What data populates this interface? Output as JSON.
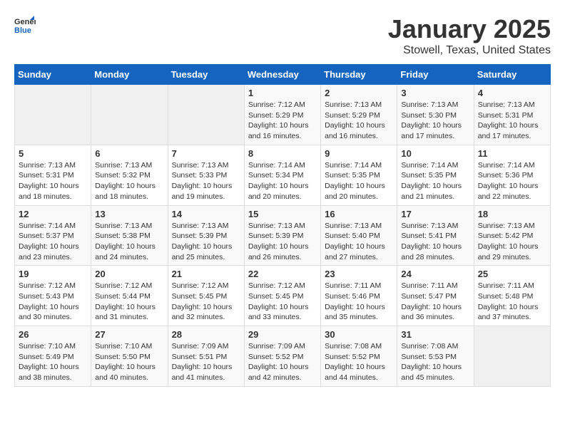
{
  "logo": {
    "general": "General",
    "blue": "Blue"
  },
  "header": {
    "title": "January 2025",
    "subtitle": "Stowell, Texas, United States"
  },
  "days_of_week": [
    "Sunday",
    "Monday",
    "Tuesday",
    "Wednesday",
    "Thursday",
    "Friday",
    "Saturday"
  ],
  "weeks": [
    [
      {
        "day": "",
        "empty": true
      },
      {
        "day": "",
        "empty": true
      },
      {
        "day": "",
        "empty": true
      },
      {
        "day": "1",
        "sunrise": "7:12 AM",
        "sunset": "5:29 PM",
        "daylight": "10 hours and 16 minutes."
      },
      {
        "day": "2",
        "sunrise": "7:13 AM",
        "sunset": "5:29 PM",
        "daylight": "10 hours and 16 minutes."
      },
      {
        "day": "3",
        "sunrise": "7:13 AM",
        "sunset": "5:30 PM",
        "daylight": "10 hours and 17 minutes."
      },
      {
        "day": "4",
        "sunrise": "7:13 AM",
        "sunset": "5:31 PM",
        "daylight": "10 hours and 17 minutes."
      }
    ],
    [
      {
        "day": "5",
        "sunrise": "7:13 AM",
        "sunset": "5:31 PM",
        "daylight": "10 hours and 18 minutes."
      },
      {
        "day": "6",
        "sunrise": "7:13 AM",
        "sunset": "5:32 PM",
        "daylight": "10 hours and 18 minutes."
      },
      {
        "day": "7",
        "sunrise": "7:13 AM",
        "sunset": "5:33 PM",
        "daylight": "10 hours and 19 minutes."
      },
      {
        "day": "8",
        "sunrise": "7:14 AM",
        "sunset": "5:34 PM",
        "daylight": "10 hours and 20 minutes."
      },
      {
        "day": "9",
        "sunrise": "7:14 AM",
        "sunset": "5:35 PM",
        "daylight": "10 hours and 20 minutes."
      },
      {
        "day": "10",
        "sunrise": "7:14 AM",
        "sunset": "5:35 PM",
        "daylight": "10 hours and 21 minutes."
      },
      {
        "day": "11",
        "sunrise": "7:14 AM",
        "sunset": "5:36 PM",
        "daylight": "10 hours and 22 minutes."
      }
    ],
    [
      {
        "day": "12",
        "sunrise": "7:14 AM",
        "sunset": "5:37 PM",
        "daylight": "10 hours and 23 minutes."
      },
      {
        "day": "13",
        "sunrise": "7:13 AM",
        "sunset": "5:38 PM",
        "daylight": "10 hours and 24 minutes."
      },
      {
        "day": "14",
        "sunrise": "7:13 AM",
        "sunset": "5:39 PM",
        "daylight": "10 hours and 25 minutes."
      },
      {
        "day": "15",
        "sunrise": "7:13 AM",
        "sunset": "5:39 PM",
        "daylight": "10 hours and 26 minutes."
      },
      {
        "day": "16",
        "sunrise": "7:13 AM",
        "sunset": "5:40 PM",
        "daylight": "10 hours and 27 minutes."
      },
      {
        "day": "17",
        "sunrise": "7:13 AM",
        "sunset": "5:41 PM",
        "daylight": "10 hours and 28 minutes."
      },
      {
        "day": "18",
        "sunrise": "7:13 AM",
        "sunset": "5:42 PM",
        "daylight": "10 hours and 29 minutes."
      }
    ],
    [
      {
        "day": "19",
        "sunrise": "7:12 AM",
        "sunset": "5:43 PM",
        "daylight": "10 hours and 30 minutes."
      },
      {
        "day": "20",
        "sunrise": "7:12 AM",
        "sunset": "5:44 PM",
        "daylight": "10 hours and 31 minutes."
      },
      {
        "day": "21",
        "sunrise": "7:12 AM",
        "sunset": "5:45 PM",
        "daylight": "10 hours and 32 minutes."
      },
      {
        "day": "22",
        "sunrise": "7:12 AM",
        "sunset": "5:45 PM",
        "daylight": "10 hours and 33 minutes."
      },
      {
        "day": "23",
        "sunrise": "7:11 AM",
        "sunset": "5:46 PM",
        "daylight": "10 hours and 35 minutes."
      },
      {
        "day": "24",
        "sunrise": "7:11 AM",
        "sunset": "5:47 PM",
        "daylight": "10 hours and 36 minutes."
      },
      {
        "day": "25",
        "sunrise": "7:11 AM",
        "sunset": "5:48 PM",
        "daylight": "10 hours and 37 minutes."
      }
    ],
    [
      {
        "day": "26",
        "sunrise": "7:10 AM",
        "sunset": "5:49 PM",
        "daylight": "10 hours and 38 minutes."
      },
      {
        "day": "27",
        "sunrise": "7:10 AM",
        "sunset": "5:50 PM",
        "daylight": "10 hours and 40 minutes."
      },
      {
        "day": "28",
        "sunrise": "7:09 AM",
        "sunset": "5:51 PM",
        "daylight": "10 hours and 41 minutes."
      },
      {
        "day": "29",
        "sunrise": "7:09 AM",
        "sunset": "5:52 PM",
        "daylight": "10 hours and 42 minutes."
      },
      {
        "day": "30",
        "sunrise": "7:08 AM",
        "sunset": "5:52 PM",
        "daylight": "10 hours and 44 minutes."
      },
      {
        "day": "31",
        "sunrise": "7:08 AM",
        "sunset": "5:53 PM",
        "daylight": "10 hours and 45 minutes."
      },
      {
        "day": "",
        "empty": true
      }
    ]
  ],
  "labels": {
    "sunrise": "Sunrise:",
    "sunset": "Sunset:",
    "daylight": "Daylight:"
  }
}
